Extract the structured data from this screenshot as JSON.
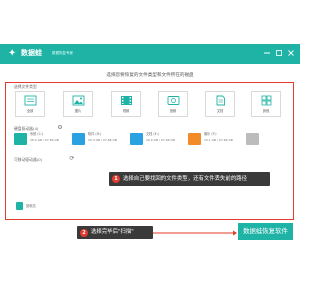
{
  "app": {
    "name": "数据蛙",
    "subtitle": "数据恢复专家",
    "window_controls": [
      "minimize",
      "maximize",
      "close"
    ]
  },
  "main": {
    "instruction": "选择您要恢复的文件类型和文件所在的磁盘"
  },
  "file_types": {
    "label": "选择文件类型",
    "items": [
      {
        "label": "全部",
        "icon": "all-files-icon"
      },
      {
        "label": "图片",
        "icon": "image-icon"
      },
      {
        "label": "视频",
        "icon": "video-icon"
      },
      {
        "label": "音频",
        "icon": "audio-icon"
      },
      {
        "label": "文档",
        "icon": "document-icon"
      },
      {
        "label": "其他",
        "icon": "other-icon"
      }
    ]
  },
  "drives": {
    "label": "硬盘驱动器(4)",
    "items": [
      {
        "name": "系统 (C:)",
        "size": "28.4 GB / 97.66 GB",
        "icon": "system-drive-icon"
      },
      {
        "name": "软件 (D:)",
        "size": "20.3 GB / 97.66 GB",
        "icon": "drive-icon"
      },
      {
        "name": "文档 (E:)",
        "size": "26.9 GB / 97.66 GB",
        "icon": "drive-icon"
      },
      {
        "name": "娱乐 (F:)",
        "size": "15.1 GB / 97.66 GB",
        "icon": "drive-icon"
      }
    ]
  },
  "removable": {
    "label": "可移动驱动器(0)",
    "device_label": "回收站"
  },
  "callouts": {
    "step1_num": "1",
    "step1_text": "选择自己要找回的文件类型，还有文件丢失前的路径",
    "step2_num": "2",
    "step2_text": "选择完毕后\"扫描\""
  },
  "brand_banner": "数据蛙恢复软件",
  "colors": {
    "accent": "#1fb3a6",
    "highlight": "#e43a2e",
    "callout_bg": "#3a3a3a"
  }
}
